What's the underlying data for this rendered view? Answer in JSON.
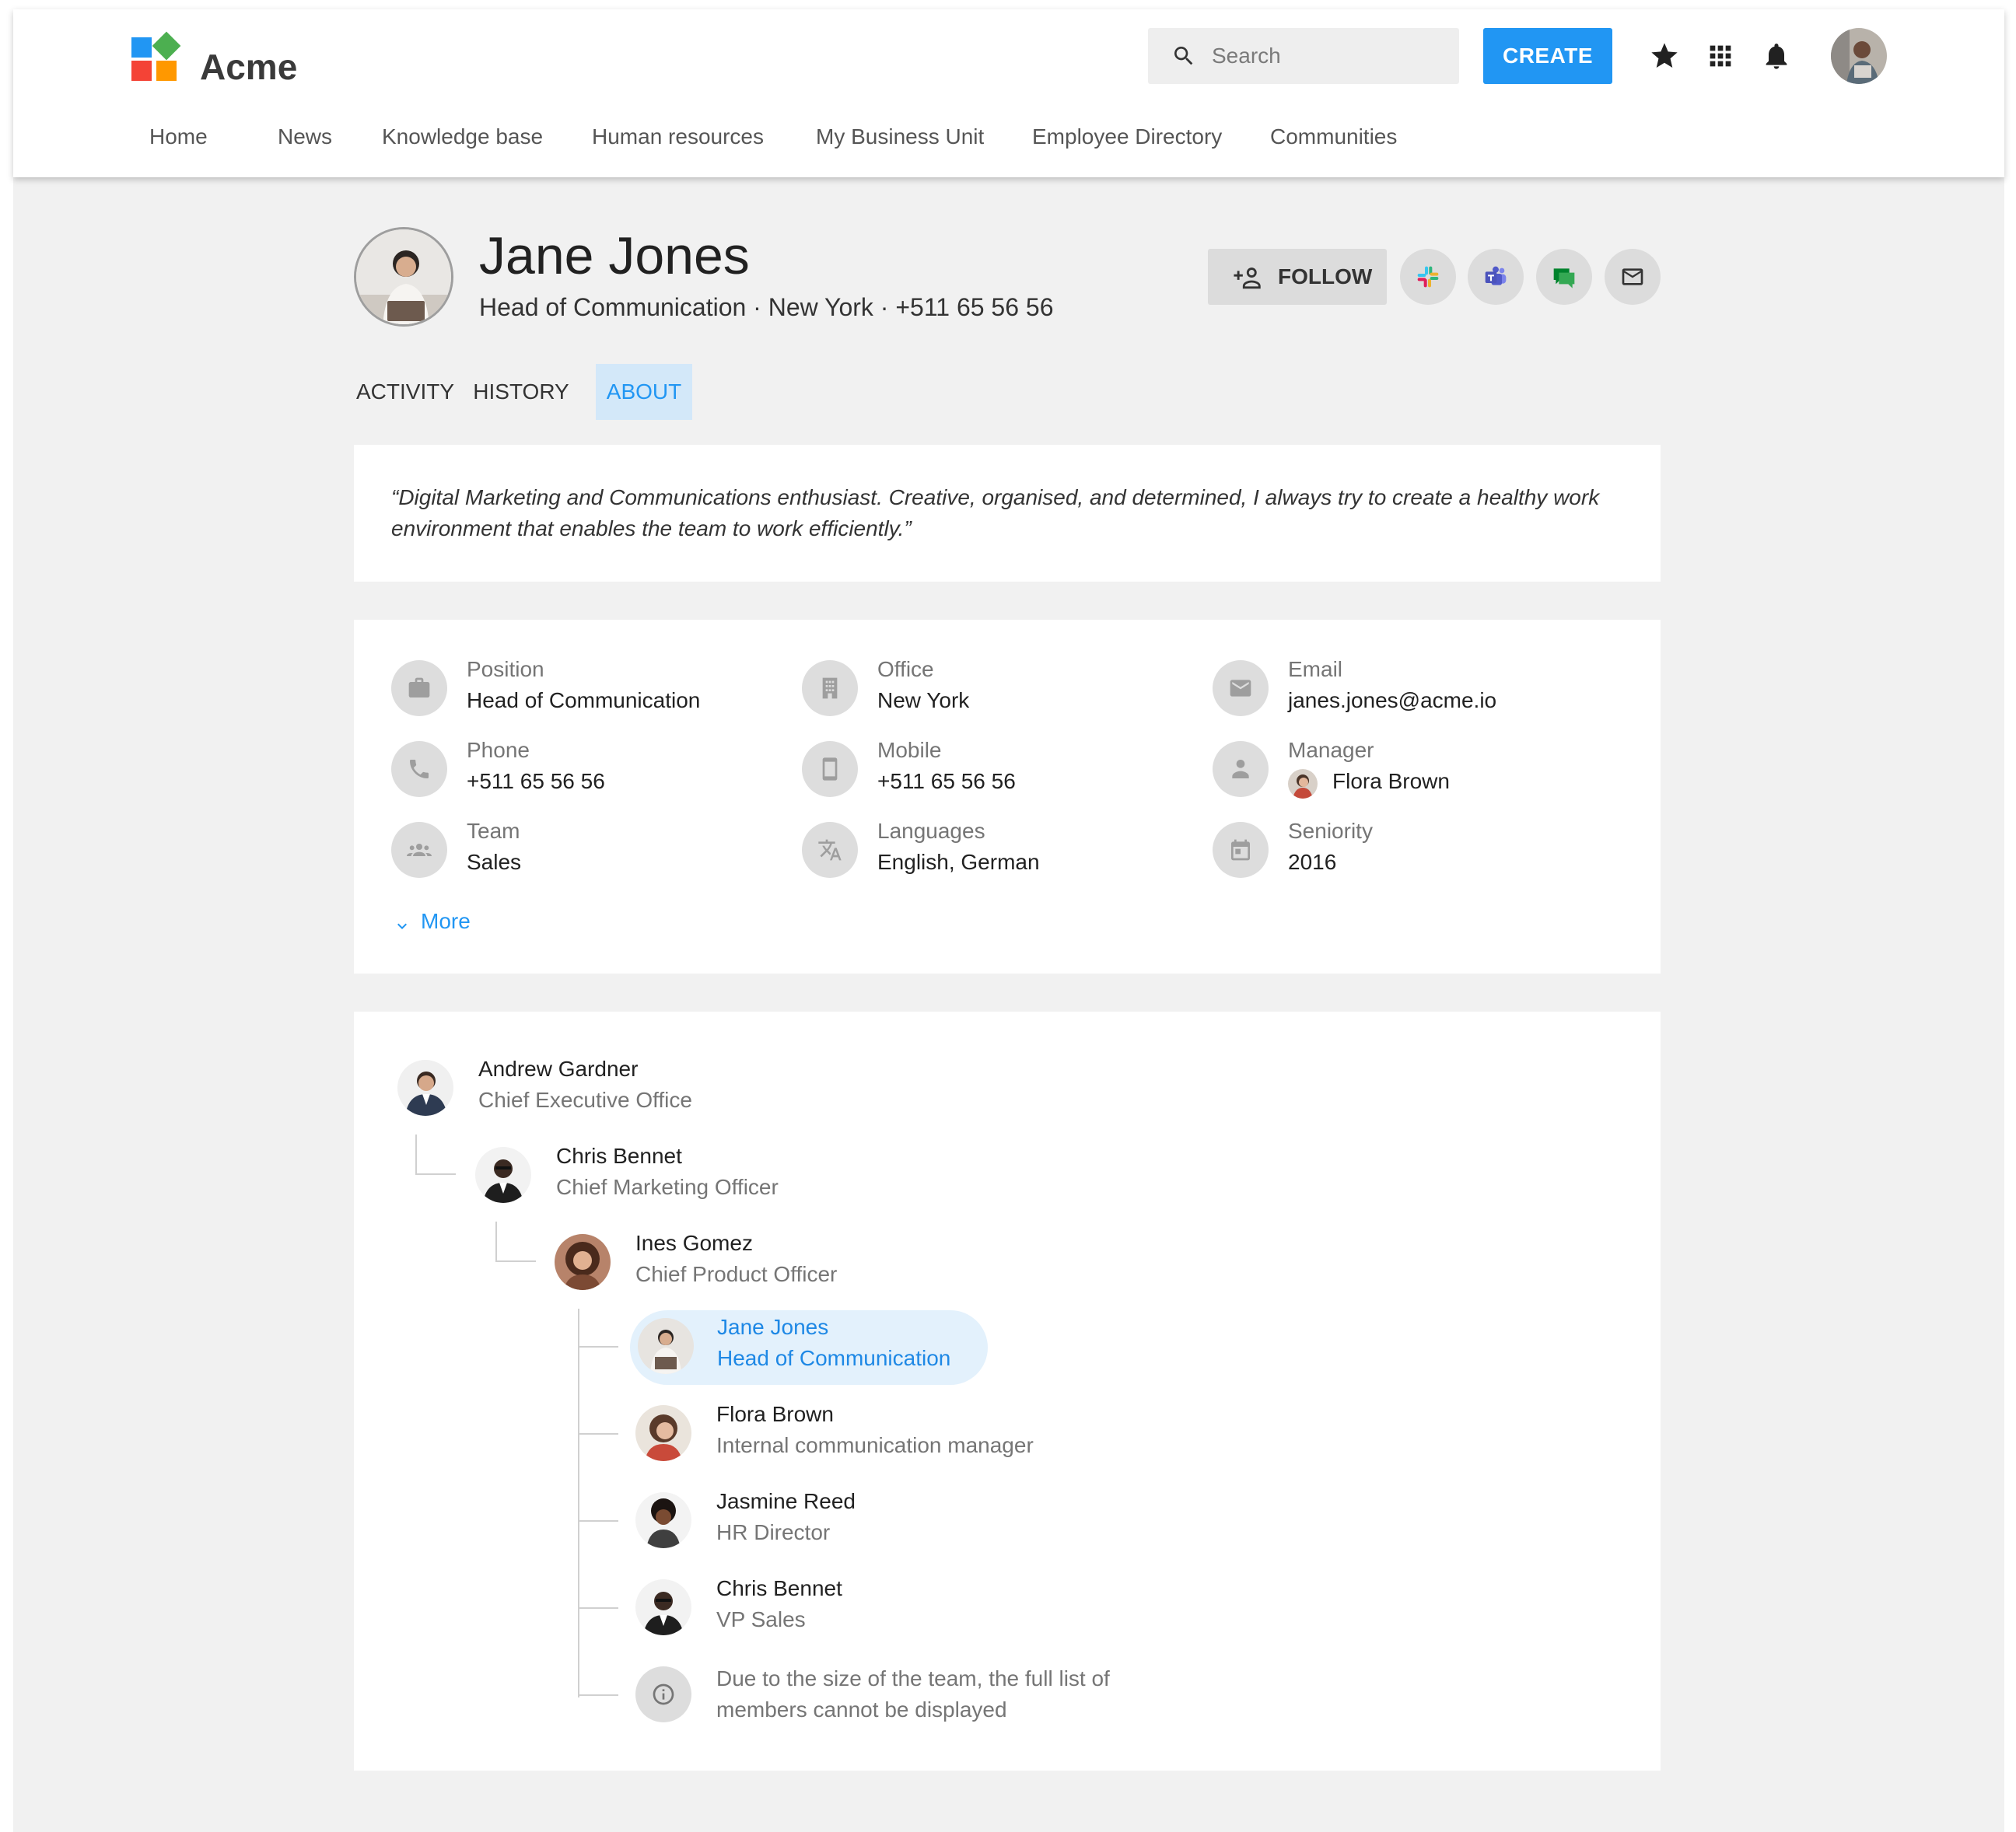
{
  "app": {
    "brand": "Acme"
  },
  "colors": {
    "accent": "#2196f3",
    "logo_blue": "#2196f3",
    "logo_green": "#4caf50",
    "logo_red": "#f44336",
    "logo_orange": "#ff9800"
  },
  "search": {
    "placeholder": "Search",
    "icon": "search-icon"
  },
  "header": {
    "create_label": "CREATE",
    "icons": [
      "star-icon",
      "apps-grid-icon",
      "bell-icon"
    ]
  },
  "nav": [
    "Home",
    "News",
    "Knowledge base",
    "Human resources",
    "My Business Unit",
    "Employee Directory",
    "Communities"
  ],
  "profile": {
    "name": "Jane Jones",
    "subtitle": "Head of Communication · New York · +511 65 56 56",
    "follow_label": "FOLLOW",
    "contact_icons": [
      "slack-icon",
      "teams-icon",
      "chat-icon",
      "mail-icon"
    ]
  },
  "tabs": [
    {
      "label": "ACTIVITY",
      "active": false
    },
    {
      "label": "HISTORY",
      "active": false
    },
    {
      "label": "ABOUT",
      "active": true
    }
  ],
  "about": {
    "quote": "“Digital Marketing and Communications enthusiast. Creative, organised, and determined, I always try to create a healthy work environment that enables the team to work efficiently.”"
  },
  "fields": [
    {
      "label": "Position",
      "value": "Head of Communication",
      "icon": "briefcase-icon"
    },
    {
      "label": "Office",
      "value": "New York",
      "icon": "building-icon"
    },
    {
      "label": "Email",
      "value": "janes.jones@acme.io",
      "icon": "email-icon"
    },
    {
      "label": "Phone",
      "value": "+511 65 56 56",
      "icon": "phone-icon"
    },
    {
      "label": "Mobile",
      "value": "+511 65 56 56",
      "icon": "mobile-icon"
    },
    {
      "label": "Manager",
      "value": "Flora Brown",
      "icon": "manager-icon"
    },
    {
      "label": "Team",
      "value": "Sales",
      "icon": "team-icon"
    },
    {
      "label": "Languages",
      "value": "English, German",
      "icon": "translate-icon"
    },
    {
      "label": "Seniority",
      "value": "2016",
      "icon": "calendar-icon"
    }
  ],
  "more_label": "More",
  "org": [
    {
      "name": "Andrew Gardner",
      "role": "Chief Executive Office"
    },
    {
      "name": "Chris Bennet",
      "role": "Chief Marketing Officer"
    },
    {
      "name": "Ines Gomez",
      "role": "Chief Product Officer"
    },
    {
      "name": "Jane Jones",
      "role": "Head of Communication",
      "current": true
    },
    {
      "name": "Flora Brown",
      "role": "Internal communication manager"
    },
    {
      "name": "Jasmine Reed",
      "role": "HR Director"
    },
    {
      "name": "Chris Bennet",
      "role": "VP Sales"
    }
  ],
  "org_notice": "Due to the size of the team, the full list of members cannot be displayed"
}
